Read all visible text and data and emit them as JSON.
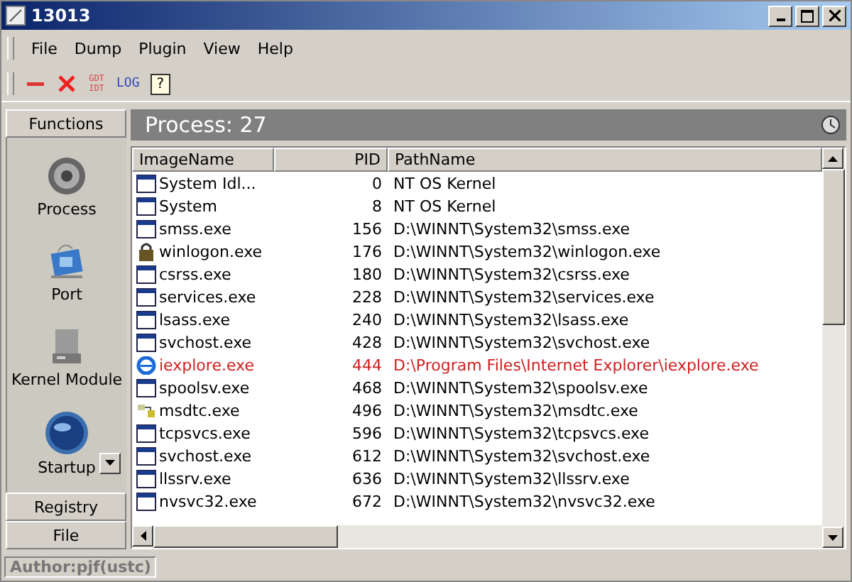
{
  "window": {
    "title": "13013"
  },
  "menu": [
    "File",
    "Dump",
    "Plugin",
    "View",
    "Help"
  ],
  "toolbar": [
    {
      "kind": "minus"
    },
    {
      "kind": "cross"
    },
    {
      "kind": "gdt",
      "text": "GDT IDT"
    },
    {
      "kind": "log",
      "text": "LOG"
    },
    {
      "kind": "help",
      "text": "?"
    }
  ],
  "sidebar": {
    "top": "Functions",
    "items": [
      {
        "label": "Process",
        "kind": "gear"
      },
      {
        "label": "Port",
        "kind": "port"
      },
      {
        "label": "Kernel Module",
        "kind": "drive"
      },
      {
        "label": "Startup",
        "kind": "globe"
      }
    ],
    "bottom": [
      "Registry",
      "File"
    ]
  },
  "panel": {
    "title": "Process: 27"
  },
  "table": {
    "columns": [
      "ImageName",
      "PID",
      "PathName"
    ],
    "rows": [
      {
        "kind": "window",
        "name": "System Idl...",
        "pid": "0",
        "path": "NT OS Kernel",
        "highlighted": false
      },
      {
        "kind": "window",
        "name": "System",
        "pid": "8",
        "path": "NT OS Kernel",
        "highlighted": false
      },
      {
        "kind": "window",
        "name": "smss.exe",
        "pid": "156",
        "path": "D:\\WINNT\\System32\\smss.exe",
        "highlighted": false
      },
      {
        "kind": "logon",
        "name": "winlogon.exe",
        "pid": "176",
        "path": "D:\\WINNT\\System32\\winlogon.exe",
        "highlighted": false
      },
      {
        "kind": "window",
        "name": "csrss.exe",
        "pid": "180",
        "path": "D:\\WINNT\\System32\\csrss.exe",
        "highlighted": false
      },
      {
        "kind": "window",
        "name": "services.exe",
        "pid": "228",
        "path": "D:\\WINNT\\System32\\services.exe",
        "highlighted": false
      },
      {
        "kind": "window",
        "name": "lsass.exe",
        "pid": "240",
        "path": "D:\\WINNT\\System32\\lsass.exe",
        "highlighted": false
      },
      {
        "kind": "window",
        "name": "svchost.exe",
        "pid": "428",
        "path": "D:\\WINNT\\System32\\svchost.exe",
        "highlighted": false
      },
      {
        "kind": "browser",
        "name": "iexplore.exe",
        "pid": "444",
        "path": "D:\\Program Files\\Internet Explorer\\iexplore.exe",
        "highlighted": true
      },
      {
        "kind": "window",
        "name": "spoolsv.exe",
        "pid": "468",
        "path": "D:\\WINNT\\System32\\spoolsv.exe",
        "highlighted": false
      },
      {
        "kind": "network",
        "name": "msdtc.exe",
        "pid": "496",
        "path": "D:\\WINNT\\System32\\msdtc.exe",
        "highlighted": false
      },
      {
        "kind": "window",
        "name": "tcpsvcs.exe",
        "pid": "596",
        "path": "D:\\WINNT\\System32\\tcpsvcs.exe",
        "highlighted": false
      },
      {
        "kind": "window",
        "name": "svchost.exe",
        "pid": "612",
        "path": "D:\\WINNT\\System32\\svchost.exe",
        "highlighted": false
      },
      {
        "kind": "window",
        "name": "llssrv.exe",
        "pid": "636",
        "path": "D:\\WINNT\\System32\\llssrv.exe",
        "highlighted": false
      },
      {
        "kind": "window",
        "name": "nvsvc32.exe",
        "pid": "672",
        "path": "D:\\WINNT\\System32\\nvsvc32.exe",
        "highlighted": false
      }
    ]
  },
  "status_bar": "Author:pjf(ustc)"
}
